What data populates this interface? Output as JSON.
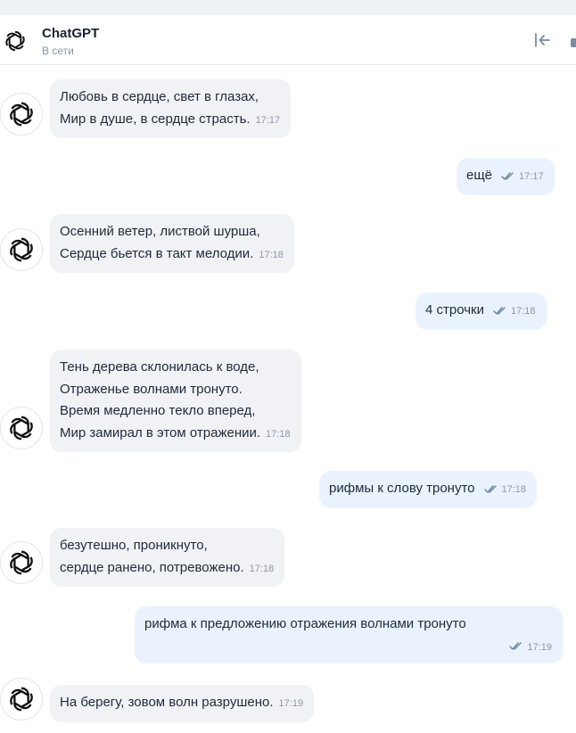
{
  "header": {
    "title": "ChatGPT",
    "status": "В сети",
    "avatar_icon": "openai-logo-icon",
    "collapse_icon": "collapse-panel-icon"
  },
  "messages": [
    {
      "dir": "in",
      "lines": [
        "Любовь в сердце, свет в глазах,",
        "Мир в душе, в сердце страсть."
      ],
      "time": "17:17"
    },
    {
      "dir": "out",
      "lines": [
        "ещё"
      ],
      "time": "17:17",
      "status_icon": "double-check-icon"
    },
    {
      "dir": "in",
      "lines": [
        "Осенний ветер, листвой шурша,",
        "Сердце бьется в такт мелодии."
      ],
      "time": "17:18"
    },
    {
      "dir": "out",
      "lines": [
        "4 строчки"
      ],
      "time": "17:18",
      "status_icon": "double-check-icon"
    },
    {
      "dir": "in",
      "lines": [
        "Тень дерева склонилась к воде,",
        "Отраженье волнами тронуто.",
        "Время медленно текло вперед,",
        "Мир замирал в этом отражении."
      ],
      "time": "17:18"
    },
    {
      "dir": "out",
      "lines": [
        "рифмы к слову тронуто"
      ],
      "time": "17:18",
      "status_icon": "double-check-icon"
    },
    {
      "dir": "in",
      "lines": [
        "безутешно, проникнуто,",
        "сердце ранено, потревожено."
      ],
      "time": "17:18"
    },
    {
      "dir": "out",
      "lines": [
        "рифма к предложению отражения волнами тронуто"
      ],
      "time": "17:19",
      "status_icon": "double-check-icon"
    },
    {
      "dir": "in",
      "lines": [
        "На берегу, зовом волн разрушено."
      ],
      "time": "17:19"
    }
  ]
}
